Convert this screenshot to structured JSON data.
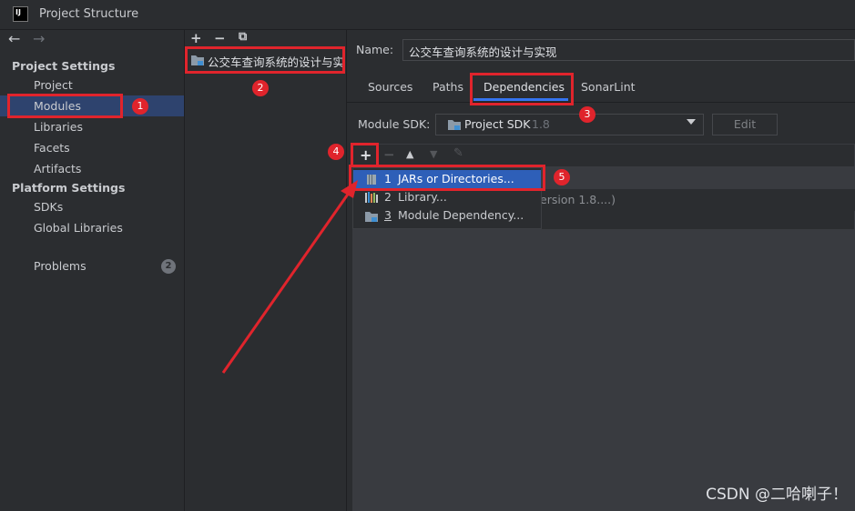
{
  "window": {
    "title": "Project Structure",
    "app_icon": "IJ"
  },
  "nav": {
    "back": "←",
    "forward": "→"
  },
  "sidebar": {
    "project_settings_title": "Project Settings",
    "project_items": [
      "Project",
      "Modules",
      "Libraries",
      "Facets",
      "Artifacts"
    ],
    "platform_settings_title": "Platform Settings",
    "platform_items": [
      "SDKs",
      "Global Libraries"
    ],
    "problems_label": "Problems",
    "problems_count": "2",
    "selected": "Modules"
  },
  "modules": {
    "toolbar": [
      "+",
      "−",
      "⧉"
    ],
    "module_name": "公交车查询系统的设计与实现"
  },
  "details": {
    "name_label": "Name:",
    "name_value": "公交车查询系统的设计与实现",
    "tabs": [
      "Sources",
      "Paths",
      "Dependencies",
      "SonarLint"
    ],
    "active_tab": "Dependencies",
    "sdk_label": "Module SDK:",
    "sdk_value": "Project SDK",
    "sdk_version": "1.8",
    "edit_label": "Edit",
    "dep_toolbar": [
      "+",
      "−",
      "▲",
      "▼",
      "✎"
    ],
    "dep_row_partial": "ersion 1.8....)"
  },
  "add_menu": {
    "items": [
      {
        "num": "1",
        "label": "JARs or Directories...",
        "icon": "jar-icon"
      },
      {
        "num": "2",
        "label": "Library...",
        "icon": "library-icon"
      },
      {
        "num": "3",
        "label": "Module Dependency...",
        "icon": "module-folder-icon"
      }
    ]
  },
  "annotations": {
    "markers": [
      "1",
      "2",
      "3",
      "4",
      "5"
    ],
    "color": "#e0242c"
  },
  "watermark": "CSDN @二哈喇子！",
  "colors": {
    "accent": "#3574f0",
    "selection": "#2e436e",
    "menu_selection": "#2e5fb8",
    "background": "#2b2d30"
  }
}
